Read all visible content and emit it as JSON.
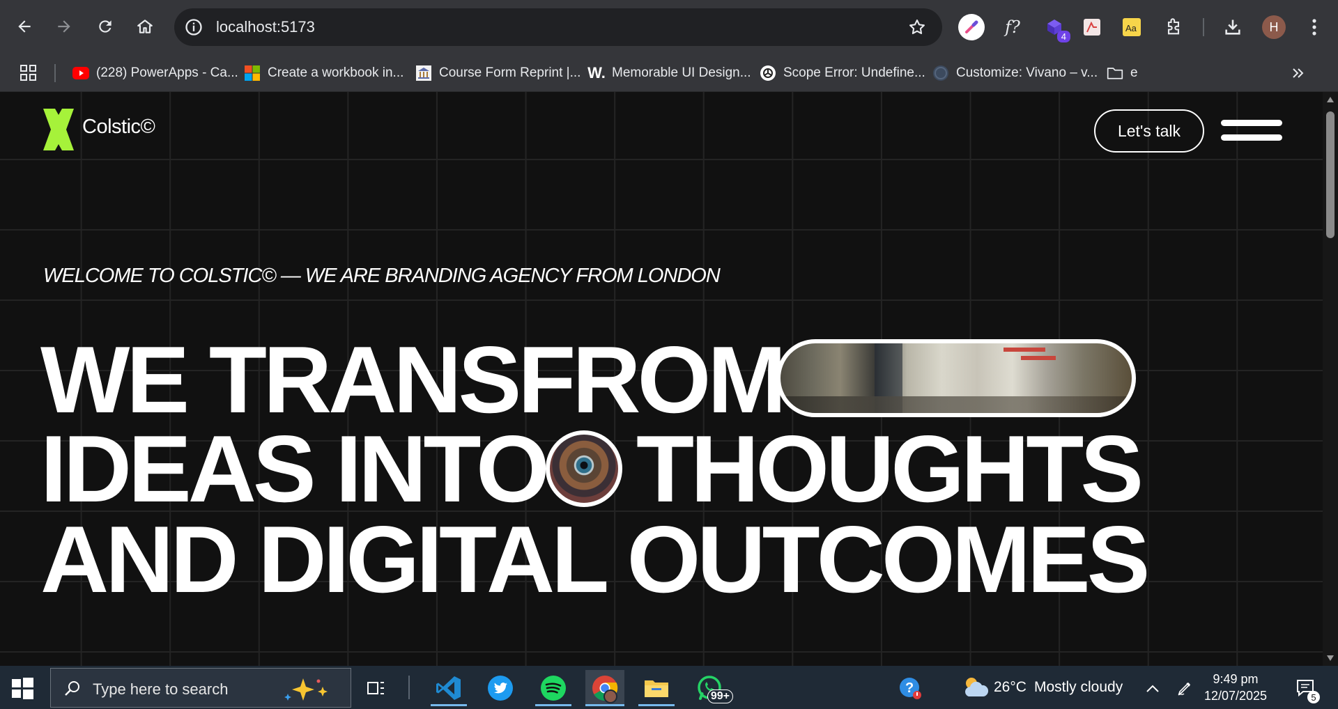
{
  "browser": {
    "url": "localhost:5173",
    "bookmarks": [
      {
        "label": "(228) PowerApps - Ca...",
        "icon": "youtube-icon"
      },
      {
        "label": "Create a workbook in...",
        "icon": "microsoft-icon"
      },
      {
        "label": "Course Form Reprint |...",
        "icon": "university-icon"
      },
      {
        "label": "Memorable UI Design...",
        "icon": "w-icon"
      },
      {
        "label": "Scope Error: Undefine...",
        "icon": "openai-icon"
      },
      {
        "label": "Customize: Vivano – v...",
        "icon": "wordpress-icon"
      },
      {
        "label": "e",
        "icon": "folder-icon"
      }
    ],
    "extension_badge": "4",
    "profile_initial": "H"
  },
  "site": {
    "logo_text": "Colstic©",
    "cta_label": "Let's talk",
    "tagline": "WELCOME TO COLSTIC© — WE ARE BRANDING AGENCY FROM LONDON",
    "hero": {
      "line1": "WE TRANSFROM",
      "line2a": "IDEAS INTO",
      "line2b": "THOUGHTS",
      "line3": "AND DIGITAL OUTCOMES"
    },
    "accent_color": "#a6f23a"
  },
  "taskbar": {
    "search_placeholder": "Type here to search",
    "whatsapp_badge": "99+",
    "weather_temp": "26°C",
    "weather_desc": "Mostly cloudy",
    "time": "9:49 pm",
    "date": "12/07/2025",
    "notification_count": "5"
  }
}
